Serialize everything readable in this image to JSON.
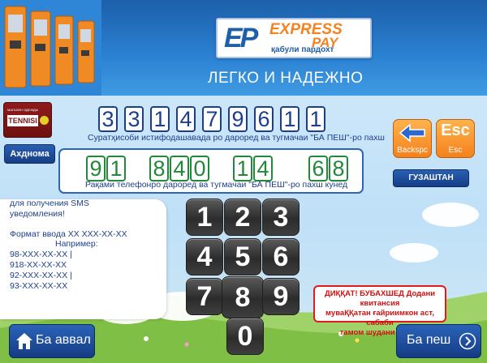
{
  "header": {
    "logo_mark": "EP",
    "logo_brand_1": "EXPRESS",
    "logo_brand_2": "PAY",
    "logo_tagline": "қабули пардохт",
    "slogan": "ЛЕГКО И НАДЕЖНО"
  },
  "provider": {
    "logo_small": "МАГАЗИН ОДЕЖДЫ",
    "logo_name": "TENNISI",
    "name_button": "Ахднома"
  },
  "account": {
    "digits": [
      "3",
      "3",
      "1",
      "4",
      "7",
      "9",
      "6",
      "1",
      "1"
    ],
    "hint": "Суратҳисоби истифодашавада ро дароред ва тугмачаи \"БА ПЕШ\"-ро пахш"
  },
  "phone": {
    "digits": [
      "9",
      "1",
      "8",
      "4",
      "0",
      "1",
      "4",
      "6",
      "8"
    ],
    "hint": "Рақами телефонро дароред ва тугмачаи \"БА ПЕШ\"-ро пахш кунед"
  },
  "controls": {
    "backspace_label": "Backspc",
    "esc_big": "Esc",
    "esc_label": "Esc",
    "skip_label": "ГУЗАШТАН"
  },
  "keypad": [
    "1",
    "2",
    "3",
    "4",
    "5",
    "6",
    "7",
    "8",
    "9",
    "0"
  ],
  "info": {
    "lines": [
      "для получения SMS",
      "уведомления!",
      "",
      "Формат ввода XX XXX-XX-XX",
      "Например:",
      "98-XXX-XX-XX   |",
      "918-XX-XX-XX",
      "92-XXX-XX-XX   |",
      "93-XXX-XX-XX"
    ]
  },
  "warning": {
    "line1": "ДИҚҚАТ! БУБАХШЕД  Додани квитансия",
    "line2": "муваҚҚатан ғайриимкон аст, сабаби",
    "line3": "тамом шудани коғоз!"
  },
  "nav": {
    "back_label": "Ба аввал",
    "next_label": "Ба пеш"
  },
  "colors": {
    "header_blue": "#1d5faa",
    "account_digit": "#1c3f8d",
    "phone_digit": "#23883a",
    "accent_orange": "#f4811c",
    "warning_red": "#e11b1b"
  }
}
